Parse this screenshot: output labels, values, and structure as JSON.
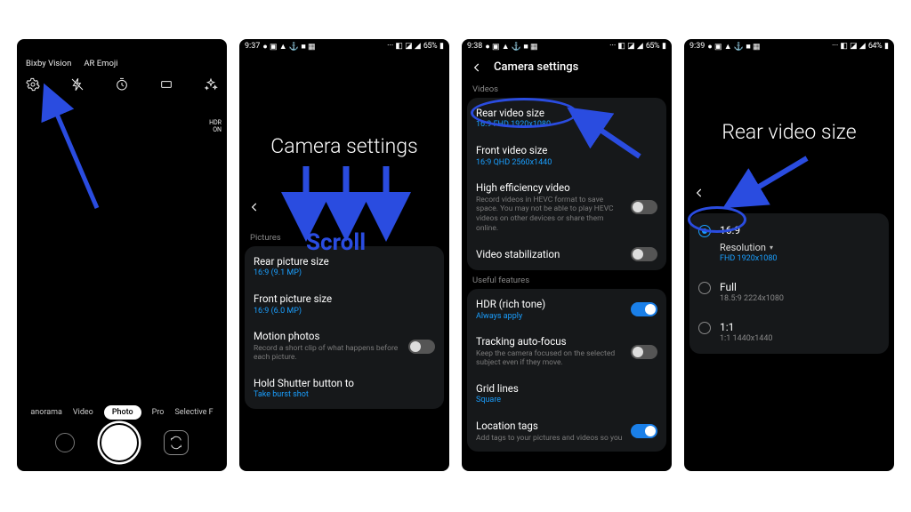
{
  "annotation": {
    "scroll_label": "Scroll"
  },
  "screen1": {
    "top_links": {
      "bixby": "Bixby Vision",
      "aremoji": "AR Emoji"
    },
    "hdr": {
      "l1": "HDR",
      "l2": "ON"
    },
    "modes": {
      "panorama": "anorama",
      "video": "Video",
      "photo": "Photo",
      "pro": "Pro",
      "selective": "Selective F"
    }
  },
  "screen2": {
    "status": {
      "time": "9:37",
      "battery": "65%"
    },
    "title": "Camera settings",
    "section": "Pictures",
    "rows": {
      "rear_pic": {
        "title": "Rear picture size",
        "sub": "16:9 (9.1 MP)"
      },
      "front_pic": {
        "title": "Front picture size",
        "sub": "16:9 (6.0 MP)"
      },
      "motion": {
        "title": "Motion photos",
        "desc": "Record a short clip of what happens before each picture."
      },
      "hold": {
        "title": "Hold Shutter button to",
        "sub": "Take burst shot"
      }
    }
  },
  "screen3": {
    "status": {
      "time": "9:38",
      "battery": "65%"
    },
    "title": "Camera settings",
    "sec_videos": "Videos",
    "sec_useful": "Useful features",
    "rows": {
      "rear_video": {
        "title": "Rear video size",
        "sub": "16:9 FHD 1920x1080"
      },
      "front_video": {
        "title": "Front video size",
        "sub": "16:9 QHD 2560x1440"
      },
      "hevc": {
        "title": "High efficiency video",
        "desc": "Record videos in HEVC format to save space. You may not be able to play HEVC videos on other devices or share them online."
      },
      "stab": {
        "title": "Video stabilization"
      },
      "hdr": {
        "title": "HDR (rich tone)",
        "sub": "Always apply"
      },
      "track": {
        "title": "Tracking auto-focus",
        "desc": "Keep the camera focused on the selected subject even if they move."
      },
      "grid": {
        "title": "Grid lines",
        "sub": "Square"
      },
      "loc": {
        "title": "Location tags",
        "desc": "Add tags to your pictures and videos so you"
      }
    }
  },
  "screen4": {
    "status": {
      "time": "9:39",
      "battery": "64%"
    },
    "title": "Rear video size",
    "options": {
      "r169": {
        "label": "16:9",
        "res_label": "Resolution",
        "res_val": "FHD 1920x1080"
      },
      "full": {
        "label": "Full",
        "sub": "18.5:9 2224x1080"
      },
      "r11": {
        "label": "1:1",
        "sub": "1:1 1440x1440"
      }
    }
  }
}
